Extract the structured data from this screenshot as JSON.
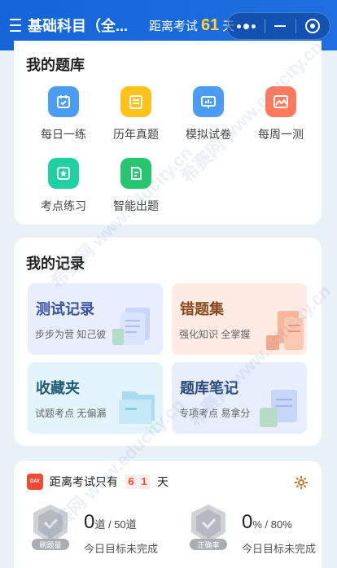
{
  "header": {
    "title": "基础科目（全...",
    "countdown_prefix": "距离考试",
    "countdown_days": "61",
    "countdown_suffix": "天"
  },
  "bank": {
    "title": "我的题库",
    "items": [
      {
        "label": "每日一练",
        "icon": "calendar-icon",
        "color": "#4b9cf5"
      },
      {
        "label": "历年真题",
        "icon": "document-icon",
        "color": "#ffc21a"
      },
      {
        "label": "模拟试卷",
        "icon": "chart-board-icon",
        "color": "#4b9cf5"
      },
      {
        "label": "每周一测",
        "icon": "image-icon",
        "color": "#ff7a5c"
      },
      {
        "label": "考点练习",
        "icon": "star-badge-icon",
        "color": "#1fd0a3"
      },
      {
        "label": "智能出题",
        "icon": "edit-doc-icon",
        "color": "#28c76f"
      }
    ]
  },
  "records": {
    "title": "我的记录",
    "tiles": [
      {
        "title": "测试记录",
        "sub": "步步为营 知己彼",
        "title_color": "#3a55a6",
        "bg": "#e9eefe"
      },
      {
        "title": "错题集",
        "sub": "强化知识 全掌握",
        "title_color": "#8a4a1e",
        "bg": "#feebe3"
      },
      {
        "title": "收藏夹",
        "sub": "试题考点 无偏漏",
        "title_color": "#1f5b73",
        "bg": "#e3f4fc"
      },
      {
        "title": "题库笔记",
        "sub": "专项考点 易拿分",
        "title_color": "#2a4a7a",
        "bg": "#e7eefc"
      }
    ]
  },
  "exam": {
    "prefix": "距离考试只有",
    "digits": [
      "6",
      "1"
    ],
    "suffix": "天",
    "calendar_label": "DAY",
    "stats": [
      {
        "value": "0",
        "unit_text": "道 / 50道",
        "sub": "今日目标未完成",
        "medal_label": "刷题量"
      },
      {
        "value": "0",
        "unit_text": "% / 80%",
        "sub": "今日目标未完成",
        "medal_label": "正确率"
      }
    ]
  },
  "watermark": "希赛网 www.educity.cn"
}
